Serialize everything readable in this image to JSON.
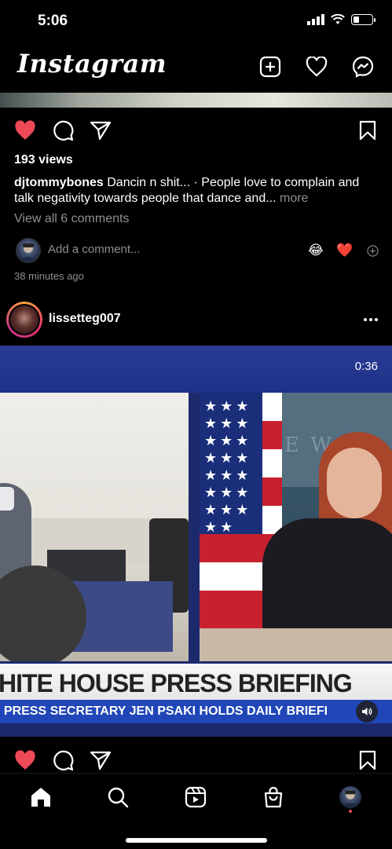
{
  "status_bar": {
    "time": "5:06"
  },
  "header": {
    "logo": "Instagram"
  },
  "post1": {
    "views": "193 views",
    "caption_user": "djtommybones",
    "caption_text": " Dancin n shit... · People love to complain and talk negativity towards people that dance and...",
    "caption_more": " more",
    "view_comments": "View all 6 comments",
    "add_comment_placeholder": "Add a comment...",
    "quick_reactions": [
      "😂",
      "❤️"
    ],
    "timestamp": "38 minutes ago"
  },
  "post2": {
    "username": "lissetteg007",
    "video_duration": "0:36",
    "lower_third_title": "HITE HOUSE PRESS BRIEFING",
    "ticker_text": "I PRESS SECRETARY JEN PSAKI HOLDS DAILY BRIEFI"
  },
  "colors": {
    "like_red": "#ed4956",
    "muted_text": "#8e8e8e",
    "background": "#000000"
  },
  "bottom_nav": {
    "items": [
      "home-icon",
      "search-icon",
      "reels-icon",
      "shop-icon",
      "profile-avatar"
    ]
  }
}
